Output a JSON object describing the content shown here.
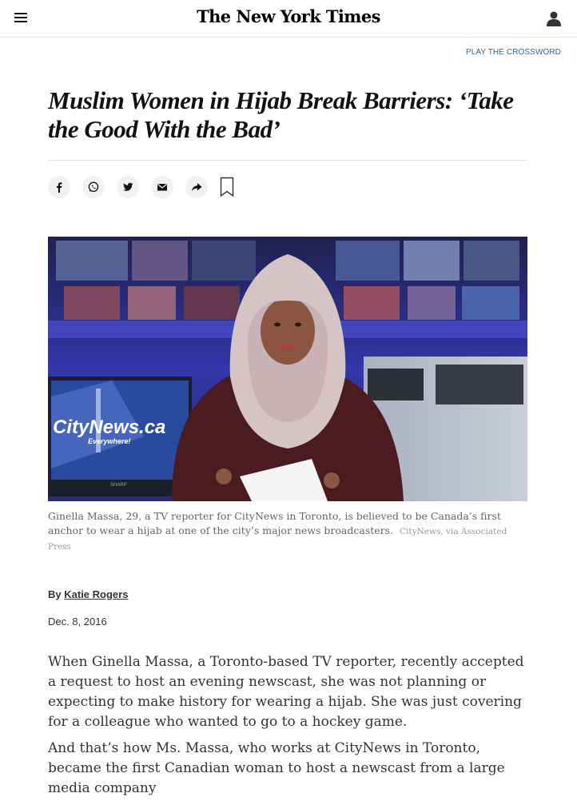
{
  "header": {
    "masthead": "The New York Times",
    "crossword_link": "PLAY THE CROSSWORD"
  },
  "article": {
    "headline": "Muslim Women in Hijab Break Barriers: ‘Take the Good With the Bad’",
    "share_icons": [
      "facebook-icon",
      "whatsapp-icon",
      "twitter-icon",
      "email-icon",
      "share-icon",
      "bookmark-icon"
    ],
    "photo": {
      "screen_text": "CityNews.ca",
      "screen_subtext": "Everywhere!",
      "monitor_brand": "SHARP"
    },
    "caption": "Ginella Massa, 29, a TV reporter for CityNews in Toronto, is believed to be Canada’s first anchor to wear a hijab at one of the city’s major news broadcasters.",
    "credit": "CityNews, via Associated Press",
    "byline_prefix": "By",
    "author": "Katie Rogers",
    "date": "Dec. 8, 2016",
    "paragraphs": [
      "When Ginella Massa, a Toronto-based TV reporter, recently accepted a request to host an evening newscast, she was not planning or expecting to make history for wearing a hijab. She was just covering for a colleague who wanted to go to a hockey game.",
      "And that’s how Ms. Massa, who works at CityNews in Toronto, became the first Canadian woman to host a newscast from a large media company"
    ]
  },
  "colors": {
    "link": "#326891",
    "text": "#121212",
    "caption": "#666666"
  }
}
